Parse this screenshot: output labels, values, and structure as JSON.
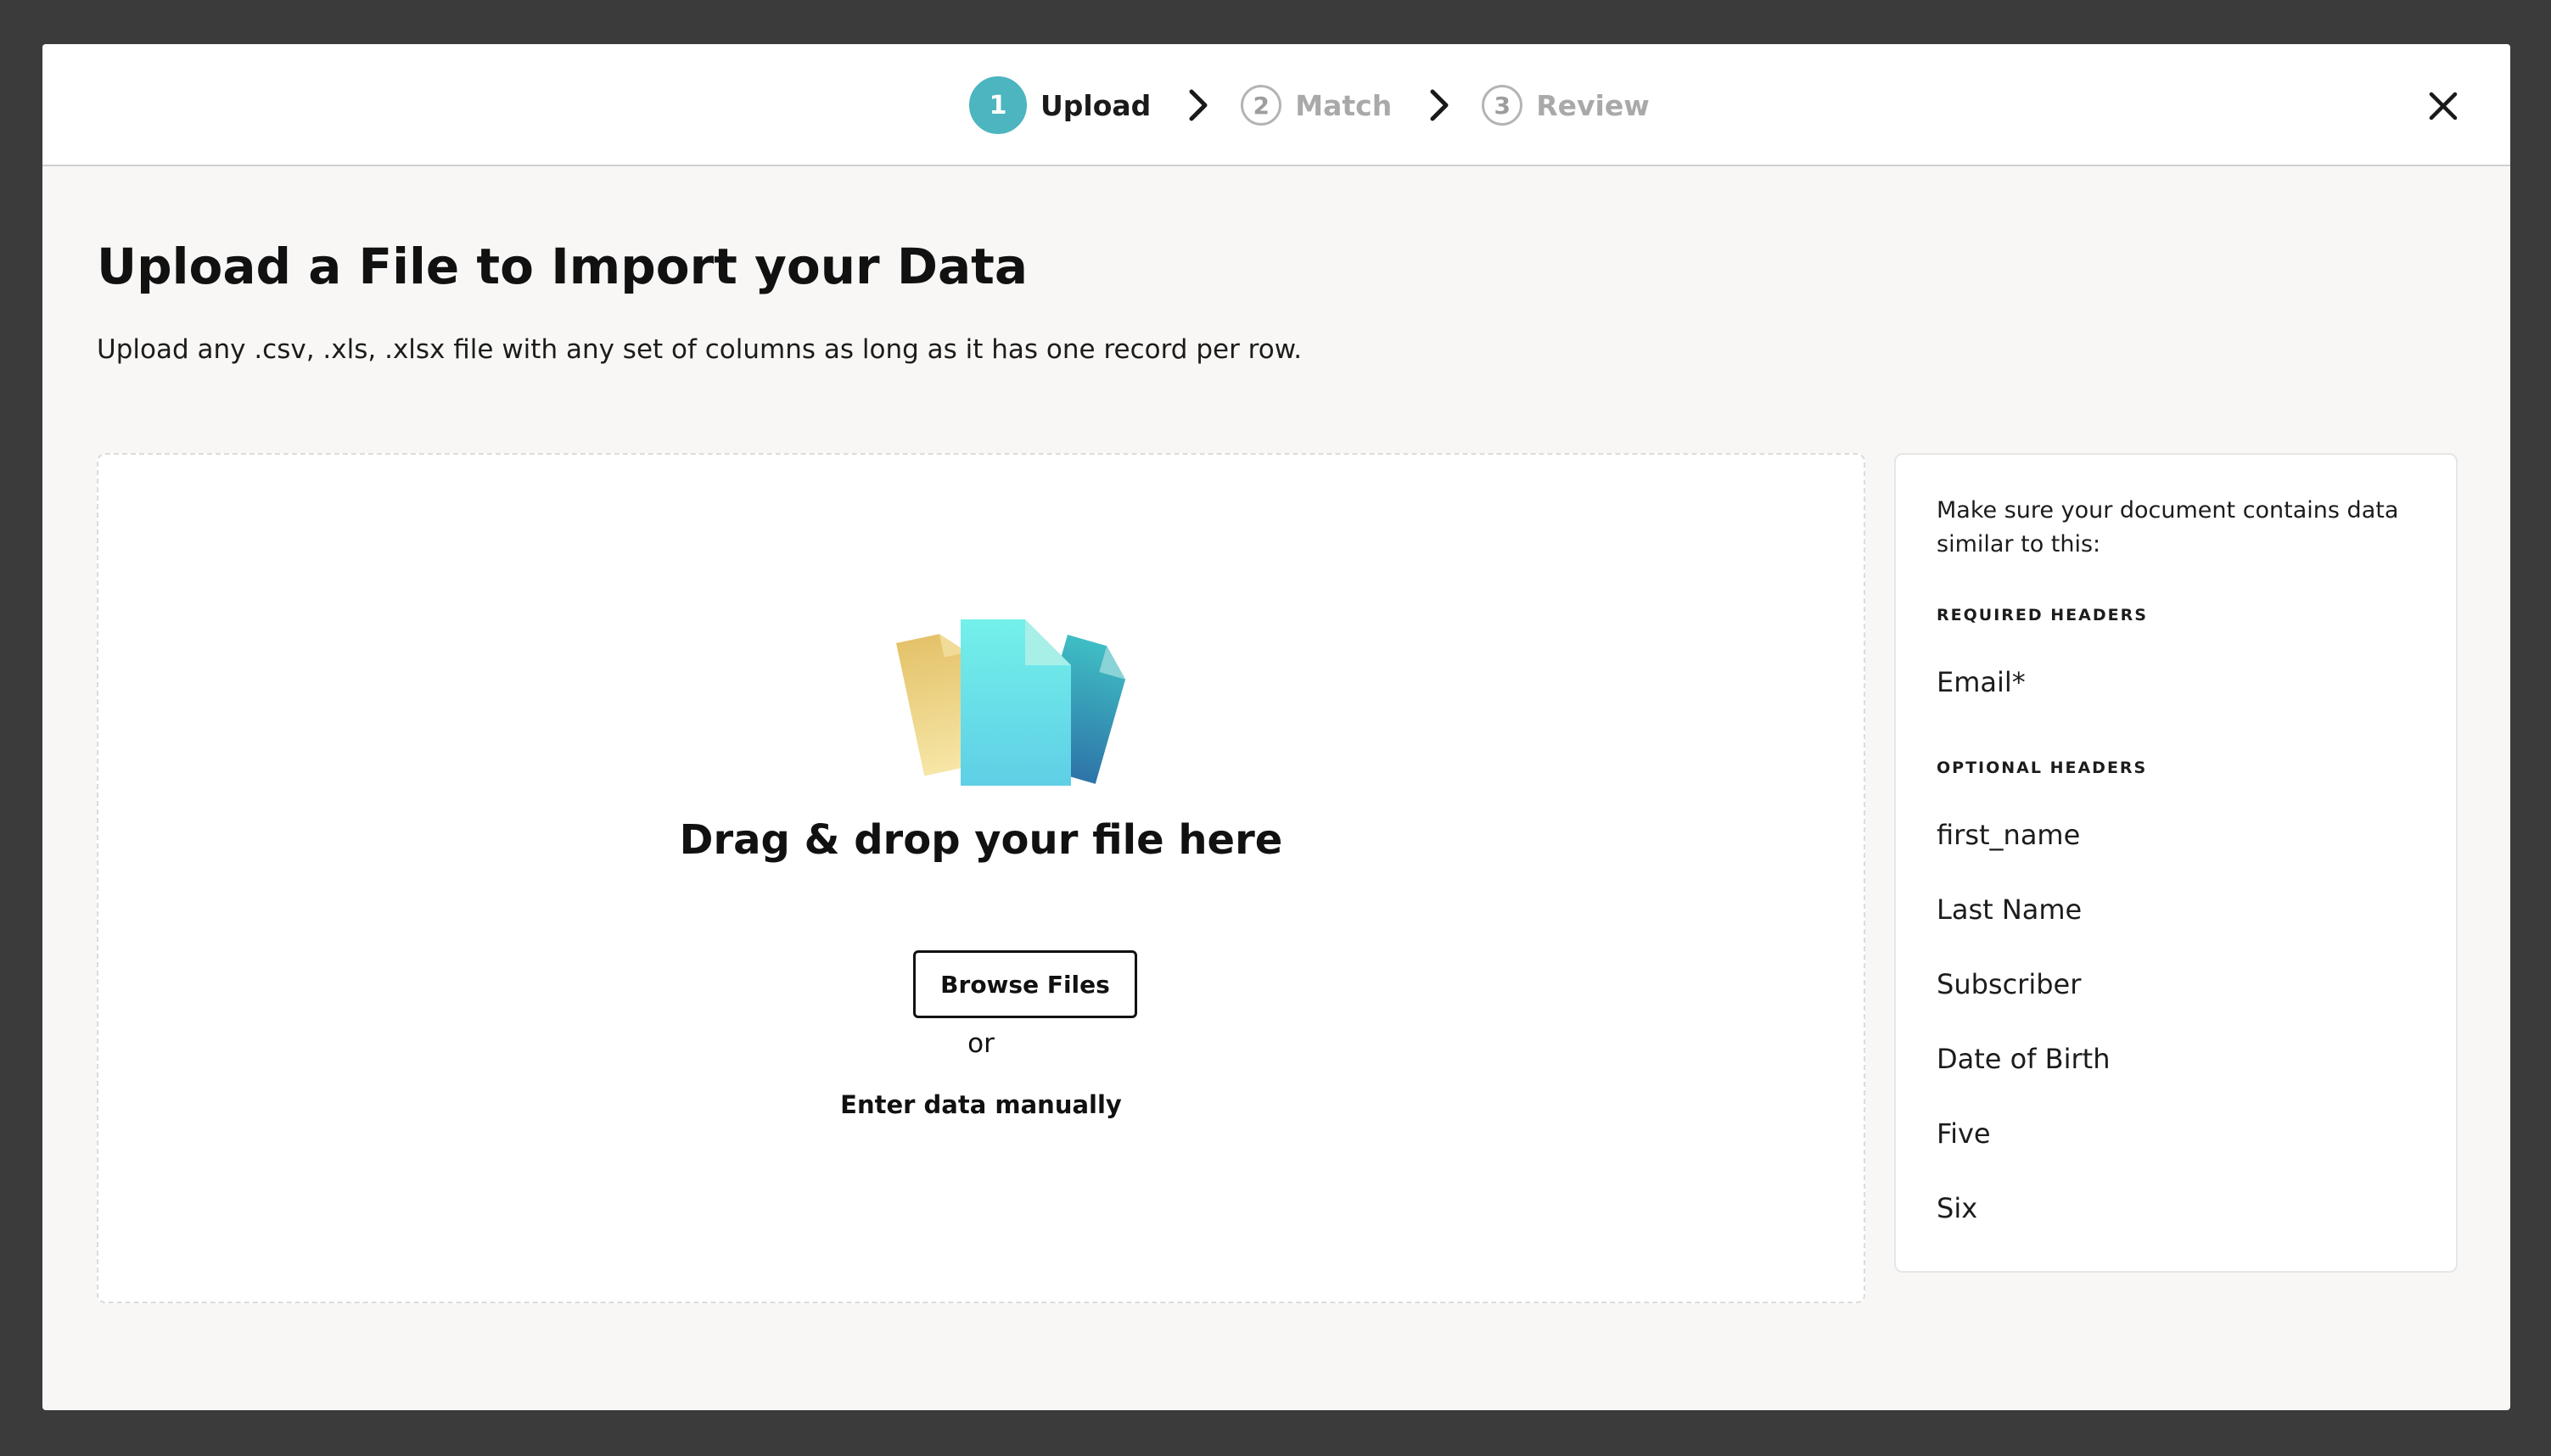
{
  "stepper": {
    "steps": [
      {
        "number": "1",
        "label": "Upload",
        "state": "active"
      },
      {
        "number": "2",
        "label": "Match",
        "state": "inactive"
      },
      {
        "number": "3",
        "label": "Review",
        "state": "inactive"
      }
    ]
  },
  "close": {
    "icon": "close-icon"
  },
  "main": {
    "title": "Upload a File to Import your Data",
    "subtitle": "Upload any .csv, .xls, .xlsx file with any set of columns as long as it has one record per row."
  },
  "dropzone": {
    "illustration": "files-illustration",
    "title": "Drag & drop your file here",
    "browse_label": "Browse Files",
    "or_text": "or",
    "manual_label": "Enter data manually"
  },
  "panel": {
    "intro": "Make sure your document contains data similar to this:",
    "required_label": "REQUIRED HEADERS",
    "required": [
      "Email*"
    ],
    "optional_label": "OPTIONAL HEADERS",
    "optional": [
      "first_name",
      "Last Name",
      "Subscriber",
      "Date of Birth",
      "Five",
      "Six"
    ]
  },
  "colors": {
    "overlay": "#3b3b3b",
    "accent": "#4cb5bf",
    "modal_bg": "#f8f7f5"
  }
}
